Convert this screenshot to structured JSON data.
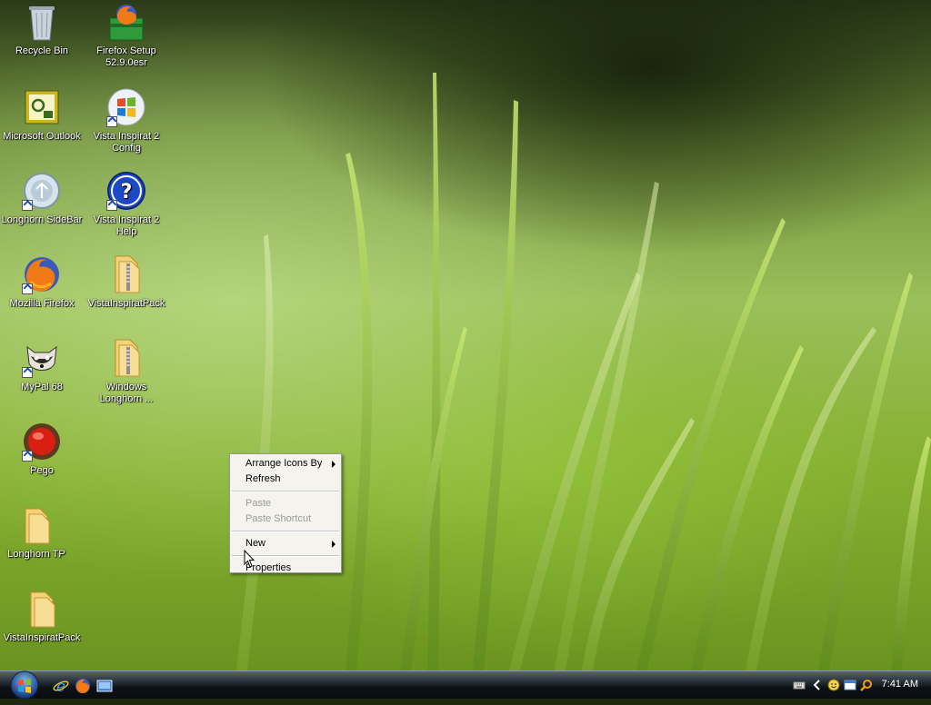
{
  "desktop": {
    "icons": [
      {
        "label": "Recycle Bin",
        "icon": "recycle-bin-icon"
      },
      {
        "label": "Firefox Setup 52.9.0esr",
        "icon": "installer-icon"
      },
      {
        "label": "Microsoft Outlook",
        "icon": "outlook-icon"
      },
      {
        "label": "Vista Inspirat 2 Config",
        "icon": "windows-logo-icon"
      },
      {
        "label": "Longhorn SideBar",
        "icon": "sidebar-icon"
      },
      {
        "label": "Vista Inspirat 2 Help",
        "icon": "help-icon"
      },
      {
        "label": "Mozilla Firefox",
        "icon": "firefox-icon"
      },
      {
        "label": "VistaInspiratPack",
        "icon": "zip-folder-icon"
      },
      {
        "label": "MyPal 68",
        "icon": "raccoon-icon"
      },
      {
        "label": "Windows Longhorn ...",
        "icon": "zip-folder-icon"
      },
      {
        "label": "Pego",
        "icon": "red-orb-icon"
      },
      {
        "label": "Longhorn TP",
        "icon": "folder-icon"
      },
      {
        "label": "VistaInspiratPack",
        "icon": "folder-icon"
      }
    ]
  },
  "context_menu": {
    "arrange": "Arrange Icons By",
    "refresh": "Refresh",
    "paste": "Paste",
    "paste_shortcut": "Paste Shortcut",
    "new": "New",
    "properties": "Properties"
  },
  "taskbar": {
    "clock": "7:41 AM",
    "quick_launch": [
      "ie-icon",
      "firefox-icon",
      "show-desktop-icon"
    ],
    "tray": [
      "keyboard-icon",
      "chevron-left-icon",
      "smiley-icon",
      "window-icon",
      "search-icon"
    ]
  },
  "colors": {
    "menu_bg": "#f4f3ee",
    "disabled_text": "#9a9a9a",
    "taskbar": "#0d1116"
  }
}
